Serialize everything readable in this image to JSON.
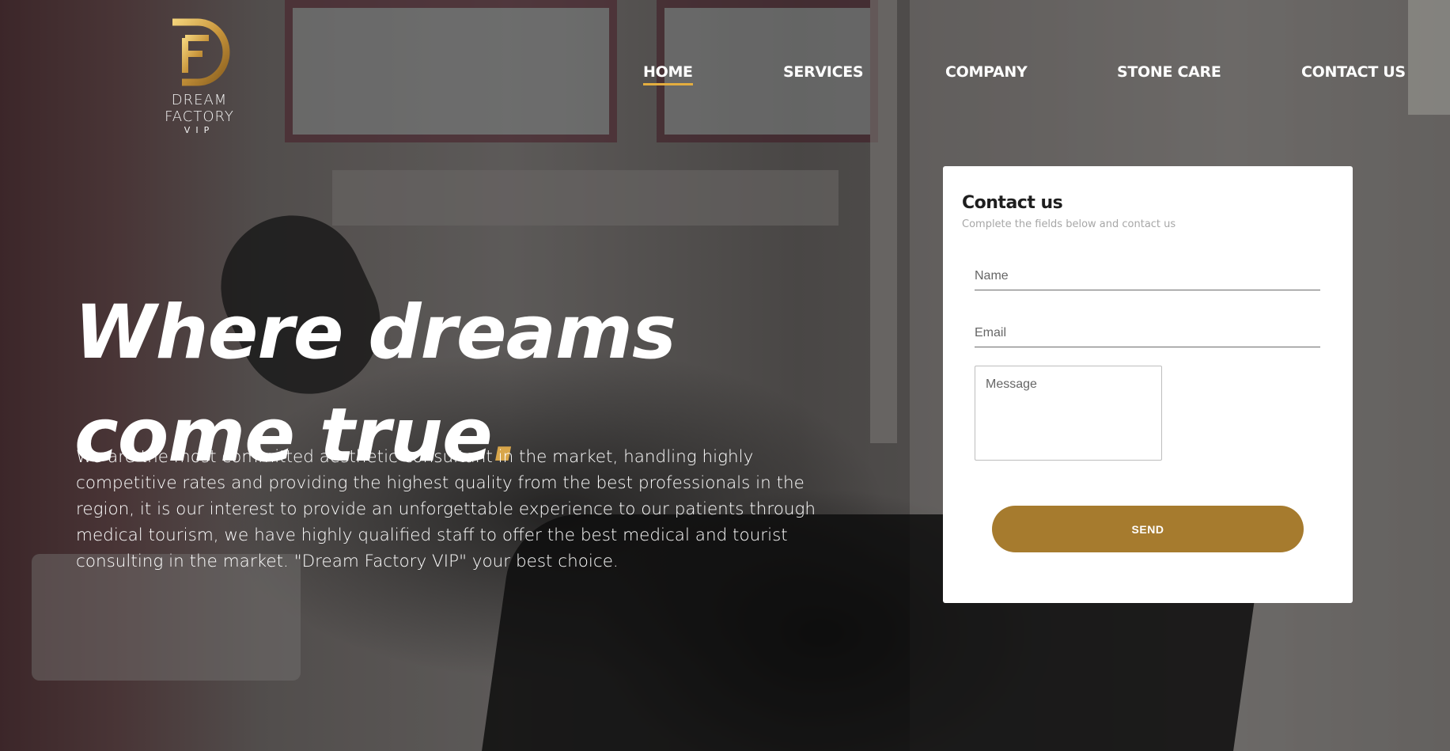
{
  "brand": {
    "name": "DREAM FACTORY",
    "sub": "VIP",
    "accent": "#d8a64a",
    "button_color": "#a67b2e",
    "logo_icon": "df-monogram-icon"
  },
  "nav": {
    "items": [
      {
        "label": "HOME",
        "active": true
      },
      {
        "label": "SERVICES",
        "active": false
      },
      {
        "label": "COMPANY",
        "active": false
      },
      {
        "label": "STONE CARE",
        "active": false
      },
      {
        "label": "CONTACT US",
        "active": false
      }
    ]
  },
  "hero": {
    "line1": "Where dreams",
    "line2": "come true",
    "dot": ".",
    "intro": "We are the most committed aesthetic consultant in the market, handling highly competitive rates and providing the highest quality from the best professionals in the region, it is our interest to provide an unforgettable experience to our patients through medical tourism, we have highly qualified staff to offer the best medical and tourist consulting in the market. \"Dream Factory VIP\" your best choice."
  },
  "contact_form": {
    "title": "Contact us",
    "subtitle": "Complete the fields below and contact us",
    "name_placeholder": "Name",
    "email_placeholder": "Email",
    "message_placeholder": "Message",
    "send_label": "SEND"
  }
}
